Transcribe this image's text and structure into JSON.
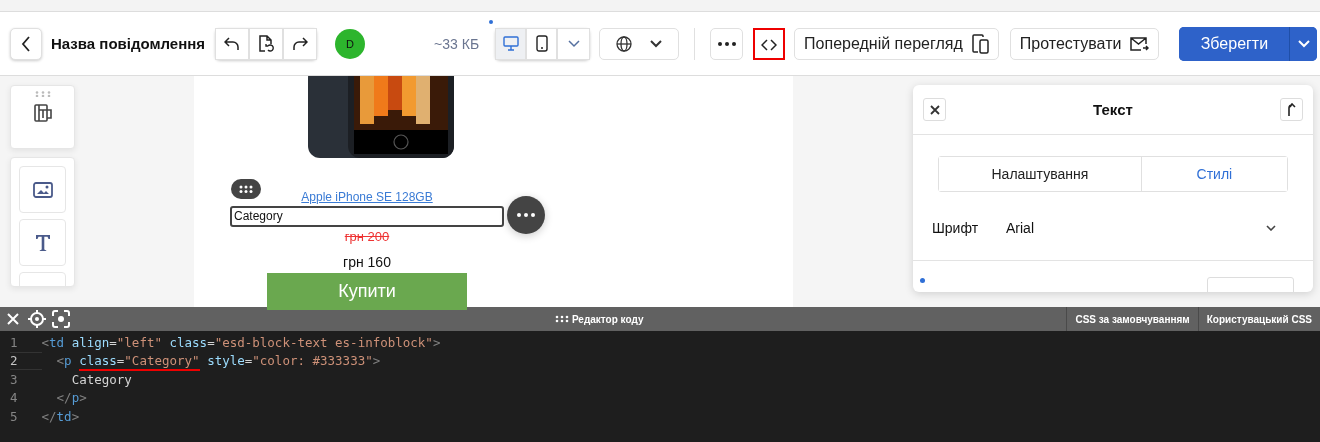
{
  "header": {
    "title": "Назва повідомлення",
    "avatar": "D",
    "size": "~33 КБ",
    "devices": [
      {
        "kind": "desktop",
        "selected": true
      },
      {
        "kind": "mobile",
        "selected": false
      }
    ],
    "code_button": {
      "selected": true
    },
    "preview_button": "Попередній перегляд",
    "test_button": "Протестувати",
    "save_button": "Зберегти"
  },
  "canvas": {
    "product_title": "Apple iPhone SE 128GB",
    "category": "Category",
    "old_price": "грн 200",
    "price": "грн 160",
    "buy_button": "Купити"
  },
  "panel": {
    "title": "Текст",
    "tabs": [
      {
        "label": "Налаштування",
        "selected": false
      },
      {
        "label": "Стилі",
        "selected": true
      }
    ],
    "font_label": "Шрифт",
    "font_value": "Arial"
  },
  "code_editor": {
    "title": "Редактор коду",
    "tabs": [
      "CSS за замовчуванням",
      "Користувацький CSS"
    ],
    "lines": [
      {
        "number": "1",
        "current": false,
        "tokens": [
          {
            "kind": "punct",
            "text": "<"
          },
          {
            "kind": "tag",
            "text": "td "
          },
          {
            "kind": "attr",
            "text": "align"
          },
          {
            "kind": "plain",
            "text": "="
          },
          {
            "kind": "string",
            "text": "\"left\""
          },
          {
            "kind": "attr",
            "text": " class"
          },
          {
            "kind": "plain",
            "text": "="
          },
          {
            "kind": "string",
            "text": "\"esd-block-text es-infoblock\""
          },
          {
            "kind": "punct",
            "text": ">"
          }
        ]
      },
      {
        "number": "2",
        "current": true,
        "tokens": [
          {
            "kind": "punct",
            "text": "  <"
          },
          {
            "kind": "tag",
            "text": "p "
          },
          {
            "kind": "underlined",
            "tokens": [
              {
                "kind": "attr",
                "text": "class"
              },
              {
                "kind": "plain",
                "text": "="
              },
              {
                "kind": "string",
                "text": "\"Category\""
              }
            ]
          },
          {
            "kind": "attr",
            "text": " style"
          },
          {
            "kind": "plain",
            "text": "="
          },
          {
            "kind": "string",
            "text": "\"color: #333333\""
          },
          {
            "kind": "punct",
            "text": ">"
          }
        ]
      },
      {
        "number": "3",
        "current": false,
        "tokens": [
          {
            "kind": "plain",
            "text": "    Category"
          }
        ]
      },
      {
        "number": "4",
        "current": false,
        "tokens": [
          {
            "kind": "punct",
            "text": "  </"
          },
          {
            "kind": "tag",
            "text": "p"
          },
          {
            "kind": "punct",
            "text": ">"
          }
        ]
      },
      {
        "number": "5",
        "current": false,
        "tokens": [
          {
            "kind": "punct",
            "text": "</"
          },
          {
            "kind": "tag",
            "text": "td"
          },
          {
            "kind": "punct",
            "text": ">"
          }
        ]
      }
    ]
  }
}
